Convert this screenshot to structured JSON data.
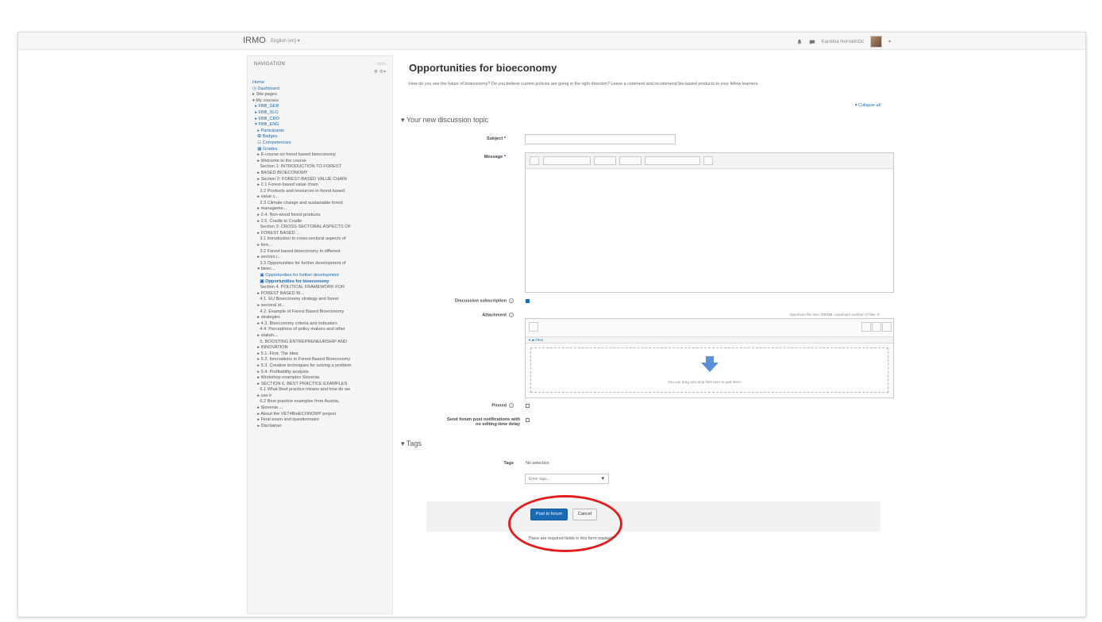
{
  "navbar": {
    "brand": "IRMO",
    "language": "English (en) ▾",
    "user_name": "Karolina Horvatinčić",
    "user_menu": "▾"
  },
  "sidebar": {
    "title": "NAVIGATION",
    "items": [
      {
        "label": "Home",
        "type": "link"
      },
      {
        "label": "◷ Dashboard",
        "type": "link"
      },
      {
        "label": "▸ Site pages",
        "type": "text"
      },
      {
        "label": "▾ My courses",
        "type": "text"
      },
      {
        "label": "  ▸ FBB_GER",
        "type": "link"
      },
      {
        "label": "  ▸ FBB_SLO",
        "type": "link"
      },
      {
        "label": "  ▸ FBB_CRO",
        "type": "link"
      },
      {
        "label": "  ▾ FBB_ENG",
        "type": "link"
      },
      {
        "label": "    ▸ Participants",
        "type": "link"
      },
      {
        "label": "    ✪ Badges",
        "type": "link"
      },
      {
        "label": "    ☷ Competencies",
        "type": "link"
      },
      {
        "label": "    ▦ Grades",
        "type": "link"
      },
      {
        "label": "    ▸ E-course on forest based bioeconomy",
        "type": "text"
      },
      {
        "label": "    ▸ Welcome to the course",
        "type": "text"
      },
      {
        "label": "      Section 1: INTRODUCTION TO FOREST",
        "type": "text"
      },
      {
        "label": "    ▸ BASED BIOECONOMY",
        "type": "text"
      },
      {
        "label": "    ▸ Section 2: FOREST-BASED VALUE CHAIN",
        "type": "text"
      },
      {
        "label": "    ▸ 2.1 Forest-based value chain",
        "type": "text"
      },
      {
        "label": "      2.2 Products and resources in forest based",
        "type": "text"
      },
      {
        "label": "    ▸ value c...",
        "type": "text"
      },
      {
        "label": "      2.3 Climate change and sustainable forest",
        "type": "text"
      },
      {
        "label": "    ▸ manageme...",
        "type": "text"
      },
      {
        "label": "    ▸ 2.4. Non-wood forest products",
        "type": "text"
      },
      {
        "label": "    ▸ 2.5. Cradle to Cradle",
        "type": "text"
      },
      {
        "label": "      Section 3: CROSS-SECTORAL ASPECTS OF",
        "type": "text"
      },
      {
        "label": "    ▸ FOREST BASED ...",
        "type": "text"
      },
      {
        "label": "      3.1 Introduction to cross-sectoral aspects of",
        "type": "text"
      },
      {
        "label": "    ▸ fore...",
        "type": "text"
      },
      {
        "label": "      3.2 Forest based bioeconomy in different",
        "type": "text"
      },
      {
        "label": "    ▸ sectors i...",
        "type": "text"
      },
      {
        "label": "      3.3 Opportunities for further development of",
        "type": "text"
      },
      {
        "label": "    ▾ bioec...",
        "type": "text"
      },
      {
        "label": "      ▣ Opportunities for further development",
        "type": "link"
      },
      {
        "label": "      ▣ Opportunities for bioeconomy",
        "type": "active"
      },
      {
        "label": "      Section 4. POLITICAL FRAMEWORK FOR",
        "type": "text"
      },
      {
        "label": "    ▸ FOREST BASED BI...",
        "type": "text"
      },
      {
        "label": "      4.1. EU Bioeconomy strategy and forest",
        "type": "text"
      },
      {
        "label": "    ▸ sectoral st...",
        "type": "text"
      },
      {
        "label": "      4.2. Example of Forest Based Bioeconomy",
        "type": "text"
      },
      {
        "label": "    ▸ strategies",
        "type": "text"
      },
      {
        "label": "    ▸ 4.3. Bioeconomy criteria and indicators",
        "type": "text"
      },
      {
        "label": "      4.4. Perceptions of policy makers and other",
        "type": "text"
      },
      {
        "label": "    ▸ stakeh...",
        "type": "text"
      },
      {
        "label": "      5. BOOSTING ENTREPRENEURSHIP AND",
        "type": "text"
      },
      {
        "label": "    ▸ INNOVATION",
        "type": "text"
      },
      {
        "label": "    ▸ 5.1. First: The Idea",
        "type": "text"
      },
      {
        "label": "    ▸ 5.2. Innovations in Forest Based Bioeconomy",
        "type": "text"
      },
      {
        "label": "    ▸ 5.3. Creative techniques for solving a problem",
        "type": "text"
      },
      {
        "label": "    ▸ 5.4. Profitability analysis",
        "type": "text"
      },
      {
        "label": "    ▸ Workshop examples Slovenia",
        "type": "text"
      },
      {
        "label": "    ▸ SECTION 6. BEST PRACTICE EXAMPLES",
        "type": "text"
      },
      {
        "label": "      6.1 What Best practice means and how do we",
        "type": "text"
      },
      {
        "label": "    ▸ use it",
        "type": "text"
      },
      {
        "label": "      6.2 Best practice examples from Austria,",
        "type": "text"
      },
      {
        "label": "    ▸ Slovenia ...",
        "type": "text"
      },
      {
        "label": "    ▸ About the VET4BioECONOMY project",
        "type": "text"
      },
      {
        "label": "    ▸ Final exam and questionnaire",
        "type": "text"
      },
      {
        "label": "    ▸ Disclaimer",
        "type": "text"
      }
    ]
  },
  "main": {
    "title": "Opportunities for bioeconomy",
    "intro": "How do you see the future of bioeconomy? Do you believe current policies are going in the right direction? Leave a comment and recommend bio-based products to your fellow learners.",
    "collapse_all": "▾ Collapse all",
    "section_topic": "▾ Your new discussion topic",
    "subject_label": "Subject",
    "subject_value": "",
    "message_label": "Message",
    "message_value": "",
    "subscription_label": "Discussion subscription",
    "subscription_checked": true,
    "attachment_label": "Attachment",
    "attachment_limits": "Maximum file size: 500MB, maximum number of files: 9",
    "files_folder": "▾ ▰ Files",
    "drop_hint": "You can drag and drop files here to add them.",
    "pinned_label": "Pinned",
    "pinned_checked": false,
    "notify_label_1": "Send forum post notifications with",
    "notify_label_2": "no editing-time delay",
    "notify_checked": false,
    "section_tags": "▾ Tags",
    "tags_label": "Tags",
    "tags_value": "No selection",
    "tags_placeholder": "Enter tags...",
    "post_button": "Post to forum",
    "cancel_button": "Cancel",
    "required_note": "There are required fields in this form marked",
    "required_mark": "*"
  },
  "colors": {
    "accent": "#1a6ab4",
    "highlight_ring": "#e31d1d",
    "drop_arrow": "#5b8fd6"
  }
}
